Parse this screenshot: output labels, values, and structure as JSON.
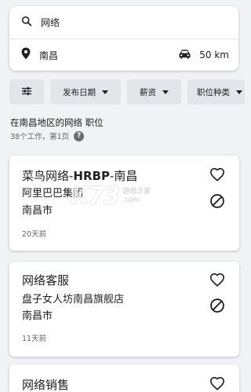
{
  "search": {
    "query": "网络",
    "location": "南昌",
    "distance": "50 km"
  },
  "filters": [
    {
      "label": "发布日期"
    },
    {
      "label": "薪资"
    },
    {
      "label": "职位种类"
    }
  ],
  "results": {
    "title": "在南昌地区的网络 职位",
    "count": "38个工作，第1页"
  },
  "jobs": [
    {
      "title_pre": "菜鸟网络-",
      "title_bold": "HRBP",
      "title_post": "-南昌",
      "company": "阿里巴巴集团",
      "location": "南昌市",
      "age": "20天前"
    },
    {
      "title": "网络客服",
      "company": "盘子女人坊南昌旗舰店",
      "location": "南昌市",
      "age": "11天前"
    },
    {
      "title": "网络销售"
    }
  ],
  "watermark": {
    "logo": "K73",
    "line1": "游戏之家",
    "line2": ".com"
  },
  "colors": {
    "background": "#f1f2f4",
    "card": "#ffffff",
    "chip": "#e4e5e8",
    "text": "#202124",
    "muted": "#5f6368"
  }
}
